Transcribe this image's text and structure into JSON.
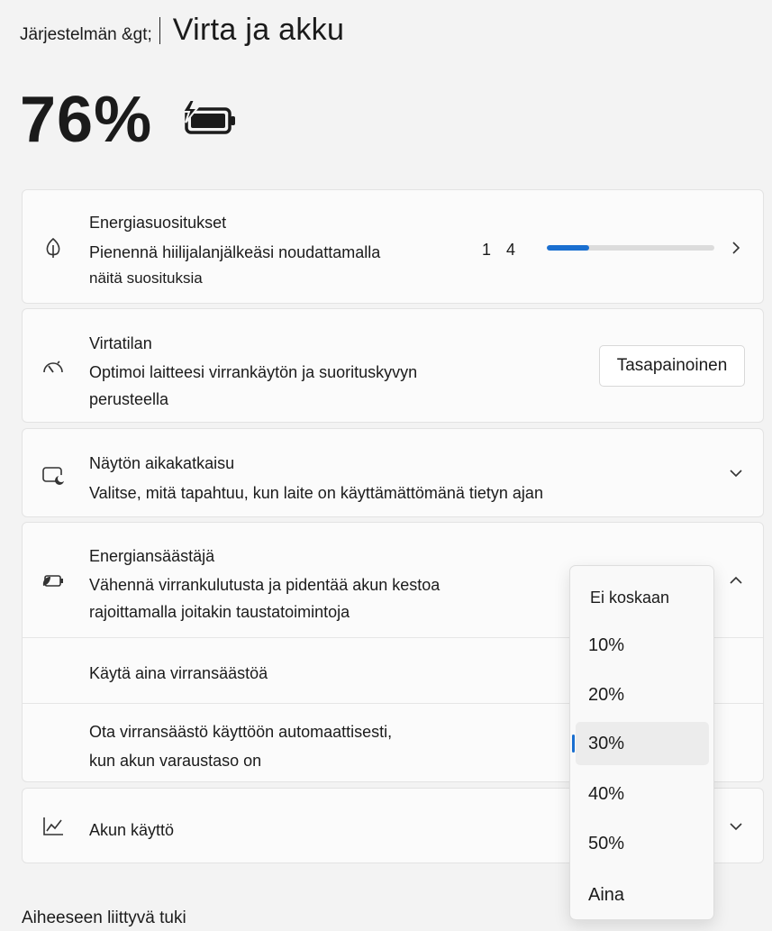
{
  "header": {
    "breadcrumb_parent": "Järjestelmän &gt;",
    "title": "Virta ja akku"
  },
  "battery": {
    "percent_text": "76%",
    "icon": "battery-charging-icon"
  },
  "recommendations": {
    "icon": "leaf-icon",
    "title": "Energiasuositukset",
    "desc_line1": "Pienennä hiilijalanjälkeäsi noudattamalla",
    "desc_line2": "näitä suosituksia",
    "count_text": "1 4",
    "progress_fraction": 0.25,
    "accent_color": "#1a6fd0"
  },
  "power_mode": {
    "icon": "gauge-icon",
    "title": "Virtatilan",
    "desc_line1": "Optimoi laitteesi virrankäytön ja suorituskyvyn",
    "desc_line2": "perusteella",
    "button_label": "Tasapainoinen"
  },
  "screen_timeout": {
    "icon": "screen-sleep-icon",
    "title": "Näytön aikakatkaisu",
    "desc": "Valitse, mitä tapahtuu, kun laite on käyttämättömänä tietyn ajan"
  },
  "energy_saver": {
    "icon": "battery-leaf-icon",
    "title": "Energiansäästäjä",
    "desc_line1": "Vähennä virrankulutusta ja pidentää akun kestoa",
    "desc_line2": "rajoittamalla joitakin taustatoimintoja",
    "always_label": "Käytä aina virransäästöä",
    "auto_line1": "Ota virransäästö käyttöön automaattisesti,",
    "auto_line2": "kun akun varaustaso on"
  },
  "battery_usage": {
    "icon": "chart-line-icon",
    "title": "Akun käyttö"
  },
  "dropdown": {
    "options": [
      "Ei koskaan",
      "10%",
      "20%",
      "30%",
      "40%",
      "50%",
      "Aina"
    ],
    "selected": "30%"
  },
  "related_support": "Aiheeseen liittyvä tuki"
}
